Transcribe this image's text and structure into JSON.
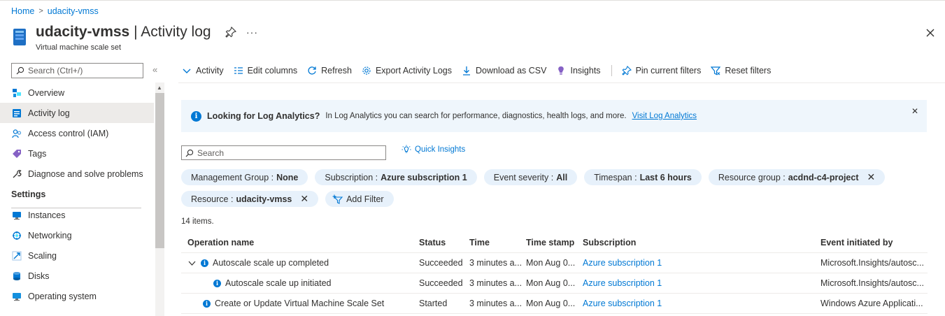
{
  "breadcrumb": {
    "home": "Home",
    "separator": ">",
    "resource": "udacity-vmss"
  },
  "header": {
    "resource_name": "udacity-vmss",
    "divider": " | ",
    "page_title": "Activity log",
    "subtitle": "Virtual machine scale set",
    "more": "···"
  },
  "sidebar": {
    "search_placeholder": "Search (Ctrl+/)",
    "collapse": "«",
    "items": [
      {
        "label": "Overview",
        "icon": "overview-icon"
      },
      {
        "label": "Activity log",
        "icon": "activity-log-icon",
        "active": true
      },
      {
        "label": "Access control (IAM)",
        "icon": "iam-icon"
      },
      {
        "label": "Tags",
        "icon": "tag-icon"
      },
      {
        "label": "Diagnose and solve problems",
        "icon": "wrench-icon"
      }
    ],
    "section_settings": "Settings",
    "settings_items": [
      {
        "label": "Instances",
        "icon": "instances-icon"
      },
      {
        "label": "Networking",
        "icon": "networking-icon"
      },
      {
        "label": "Scaling",
        "icon": "scaling-icon"
      },
      {
        "label": "Disks",
        "icon": "disks-icon"
      },
      {
        "label": "Operating system",
        "icon": "os-icon"
      }
    ]
  },
  "toolbar": {
    "activity": "Activity",
    "edit_columns": "Edit columns",
    "refresh": "Refresh",
    "export": "Export Activity Logs",
    "download": "Download as CSV",
    "insights": "Insights",
    "pin_filters": "Pin current filters",
    "reset_filters": "Reset filters"
  },
  "banner": {
    "title": "Looking for Log Analytics?",
    "text": "In Log Analytics you can search for performance, diagnostics, health logs, and more.",
    "link": "Visit Log Analytics",
    "close": "✕"
  },
  "search": {
    "placeholder": "Search",
    "quick_insights": "Quick Insights"
  },
  "filters": {
    "row1": [
      {
        "key": "Management Group : ",
        "value": "None",
        "removable": false
      },
      {
        "key": "Subscription : ",
        "value": "Azure subscription 1",
        "removable": false
      },
      {
        "key": "Event severity : ",
        "value": "All",
        "removable": false
      },
      {
        "key": "Timespan : ",
        "value": "Last 6 hours",
        "removable": false
      },
      {
        "key": "Resource group : ",
        "value": "acdnd-c4-project",
        "removable": true
      }
    ],
    "row2": [
      {
        "key": "Resource : ",
        "value": "udacity-vmss",
        "removable": true
      }
    ],
    "add_filter": "Add Filter",
    "remove_glyph": "✕"
  },
  "items_count": "14 items.",
  "table": {
    "columns": [
      "Operation name",
      "Status",
      "Time",
      "Time stamp",
      "Subscription",
      "Event initiated by"
    ],
    "rows": [
      {
        "operation": "Autoscale scale up completed",
        "status": "Succeeded",
        "time": "3 minutes a...",
        "timestamp": "Mon Aug 0...",
        "subscription": "Azure subscription 1",
        "initiated_by": "Microsoft.Insights/autosc...",
        "expandable": true,
        "indent": 0
      },
      {
        "operation": "Autoscale scale up initiated",
        "status": "Succeeded",
        "time": "3 minutes a...",
        "timestamp": "Mon Aug 0...",
        "subscription": "Azure subscription 1",
        "initiated_by": "Microsoft.Insights/autosc...",
        "expandable": false,
        "indent": 1
      },
      {
        "operation": "Create or Update Virtual Machine Scale Set",
        "status": "Started",
        "time": "3 minutes a...",
        "timestamp": "Mon Aug 0...",
        "subscription": "Azure subscription 1",
        "initiated_by": "Windows Azure Applicati...",
        "expandable": false,
        "indent": 0
      }
    ]
  },
  "colors": {
    "accent": "#0078d4",
    "pill_bg": "#e7f1fb",
    "banner_bg": "#eff6fc",
    "active_bg": "#edebe9"
  }
}
